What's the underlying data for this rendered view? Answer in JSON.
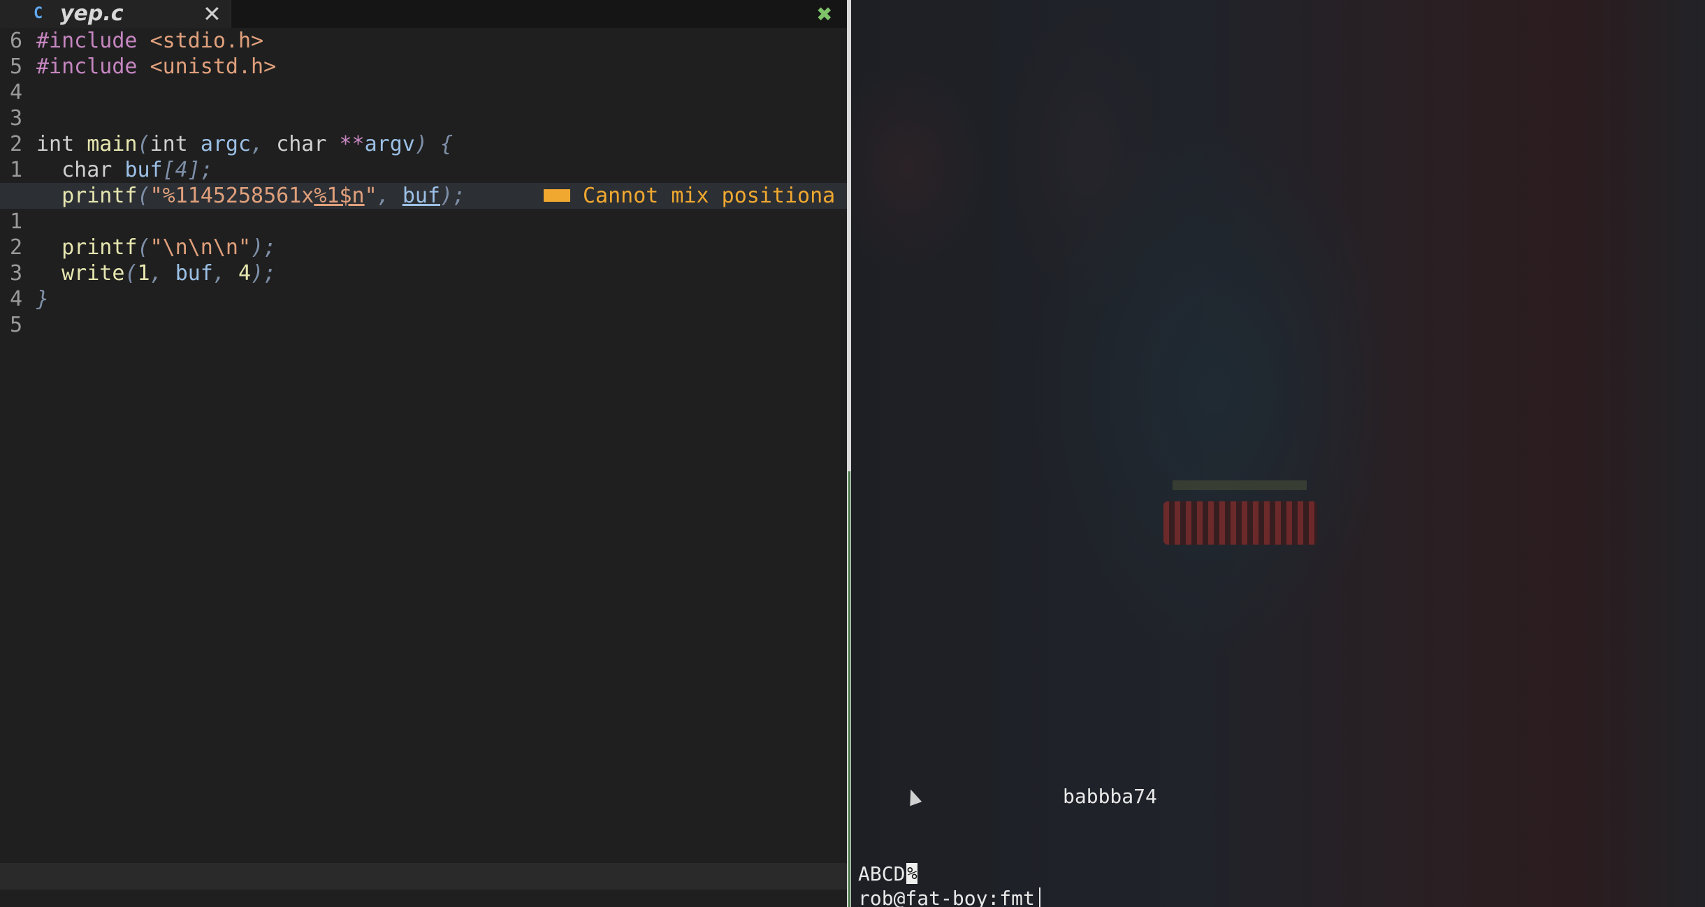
{
  "editor": {
    "tab": {
      "title": "yep.c",
      "icon": "c-language-icon",
      "close_glyph": "✕"
    },
    "status_glyph": "✖",
    "diagnostic": {
      "text": "Cannot mix positiona",
      "color": "#f0a830"
    },
    "lines": [
      {
        "ln": "6"
      },
      {
        "ln": "5"
      },
      {
        "ln": "4"
      },
      {
        "ln": "3"
      },
      {
        "ln": "2"
      },
      {
        "ln": "1"
      },
      {
        "ln": ""
      },
      {
        "ln": "1"
      },
      {
        "ln": "2"
      },
      {
        "ln": "3"
      },
      {
        "ln": "4"
      },
      {
        "ln": "5"
      }
    ],
    "code": {
      "l1_a": "#include ",
      "l1_b": "<stdio.h>",
      "l2_a": "#include ",
      "l2_b": "<unistd.h>",
      "l5_int": "int ",
      "l5_main": "main",
      "l5_p1": "(",
      "l5_int2": "int ",
      "l5_argc": "argc",
      "l5_c1": ", ",
      "l5_char": "char ",
      "l5_stars": "**",
      "l5_argv": "argv",
      "l5_end": ") {",
      "l6_char": "  char ",
      "l6_buf": "buf",
      "l6_rest": "[4];",
      "l7_printf": "  printf",
      "l7_p": "(",
      "l7_q1": "\"%1145258561x",
      "l7_fmt": "%1$n",
      "l7_q2": "\"",
      "l7_c": ", ",
      "l7_buf": "buf",
      "l7_end": ");",
      "l9_printf": "  printf",
      "l9_p": "(",
      "l9_str": "\"\\n\\n\\n\"",
      "l9_end": ");",
      "l10_write": "  write",
      "l10_p": "(",
      "l10_one": "1",
      "l10_c1": ", ",
      "l10_buf": "buf",
      "l10_c2": ", ",
      "l10_four": "4",
      "l10_end": ");",
      "l11_brace": "}"
    }
  },
  "terminal": {
    "line_output_1": "babbba74",
    "line_output_2": "ABCD",
    "cursor_char": "%",
    "prompt": "rob@fat-boy:fmt"
  }
}
